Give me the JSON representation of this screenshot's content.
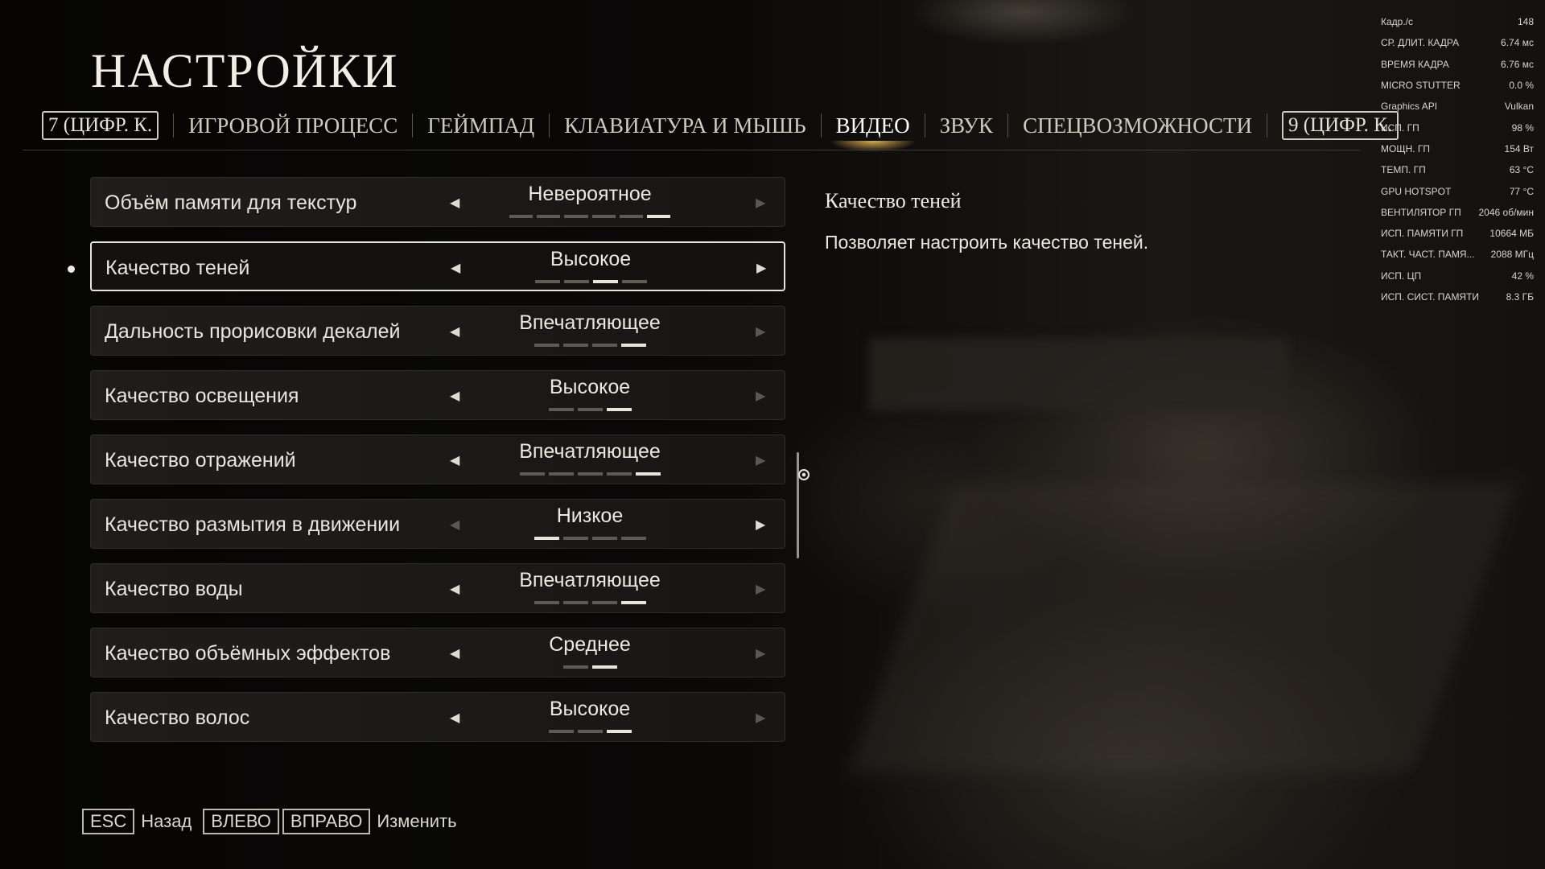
{
  "title": "НАСТРОЙКИ",
  "tabs": {
    "prev_key": "7 (ЦИФР. К.",
    "next_key": "9 (ЦИФР. К.",
    "items": [
      {
        "label": "ИГРОВОЙ ПРОЦЕСС",
        "active": false
      },
      {
        "label": "ГЕЙМПАД",
        "active": false
      },
      {
        "label": "КЛАВИАТУРА И МЫШЬ",
        "active": false
      },
      {
        "label": "ВИДЕО",
        "active": true
      },
      {
        "label": "ЗВУК",
        "active": false
      },
      {
        "label": "СПЕЦВОЗМОЖНОСТИ",
        "active": false
      }
    ]
  },
  "settings": [
    {
      "label": "Объём памяти для текстур",
      "value": "Невероятное",
      "level": 6,
      "levels": 6,
      "left_enabled": true,
      "right_enabled": false,
      "selected": false
    },
    {
      "label": "Качество теней",
      "value": "Высокое",
      "level": 3,
      "levels": 4,
      "left_enabled": true,
      "right_enabled": true,
      "selected": true
    },
    {
      "label": "Дальность прорисовки декалей",
      "value": "Впечатляющее",
      "level": 4,
      "levels": 4,
      "left_enabled": true,
      "right_enabled": false,
      "selected": false
    },
    {
      "label": "Качество освещения",
      "value": "Высокое",
      "level": 3,
      "levels": 3,
      "left_enabled": true,
      "right_enabled": false,
      "selected": false
    },
    {
      "label": "Качество отражений",
      "value": "Впечатляющее",
      "level": 5,
      "levels": 5,
      "left_enabled": true,
      "right_enabled": false,
      "selected": false
    },
    {
      "label": "Качество размытия в движении",
      "value": "Низкое",
      "level": 1,
      "levels": 4,
      "left_enabled": false,
      "right_enabled": true,
      "selected": false
    },
    {
      "label": "Качество воды",
      "value": "Впечатляющее",
      "level": 4,
      "levels": 4,
      "left_enabled": true,
      "right_enabled": false,
      "selected": false
    },
    {
      "label": "Качество объёмных эффектов",
      "value": "Среднее",
      "level": 2,
      "levels": 2,
      "left_enabled": true,
      "right_enabled": false,
      "selected": false
    },
    {
      "label": "Качество волос",
      "value": "Высокое",
      "level": 3,
      "levels": 3,
      "left_enabled": true,
      "right_enabled": false,
      "selected": false
    }
  ],
  "description": {
    "title": "Качество теней",
    "text": "Позволяет настроить качество теней."
  },
  "footer": {
    "back_key": "ESC",
    "back_label": "Назад",
    "left_key": "ВЛЕВО",
    "right_key": "ВПРАВО",
    "change_label": "Изменить"
  },
  "osd": [
    {
      "label": "Кадр./с",
      "value": "148"
    },
    {
      "label": "СР. ДЛИТ. КАДРА",
      "value": "6.74 мс"
    },
    {
      "label": "ВРЕМЯ КАДРА",
      "value": "6.76 мс"
    },
    {
      "label": "MICRO STUTTER",
      "value": "0.0 %"
    },
    {
      "label": "Graphics API",
      "value": "Vulkan"
    },
    {
      "label": "ИСП. ГП",
      "value": "98 %"
    },
    {
      "label": "МОЩН. ГП",
      "value": "154 Вт"
    },
    {
      "label": "ТЕМП. ГП",
      "value": "63 °C"
    },
    {
      "label": "GPU HOTSPOT",
      "value": "77 °C"
    },
    {
      "label": "ВЕНТИЛЯТОР ГП",
      "value": "2046 об/мин"
    },
    {
      "label": "ИСП. ПАМЯТИ ГП",
      "value": "10664 МБ"
    },
    {
      "label": "ТАКТ. ЧАСТ. ПАМЯ...",
      "value": "2088 МГц"
    },
    {
      "label": "ИСП. ЦП",
      "value": "42 %"
    },
    {
      "label": "ИСП. СИСТ. ПАМЯТИ",
      "value": "8.3 ГБ"
    }
  ]
}
